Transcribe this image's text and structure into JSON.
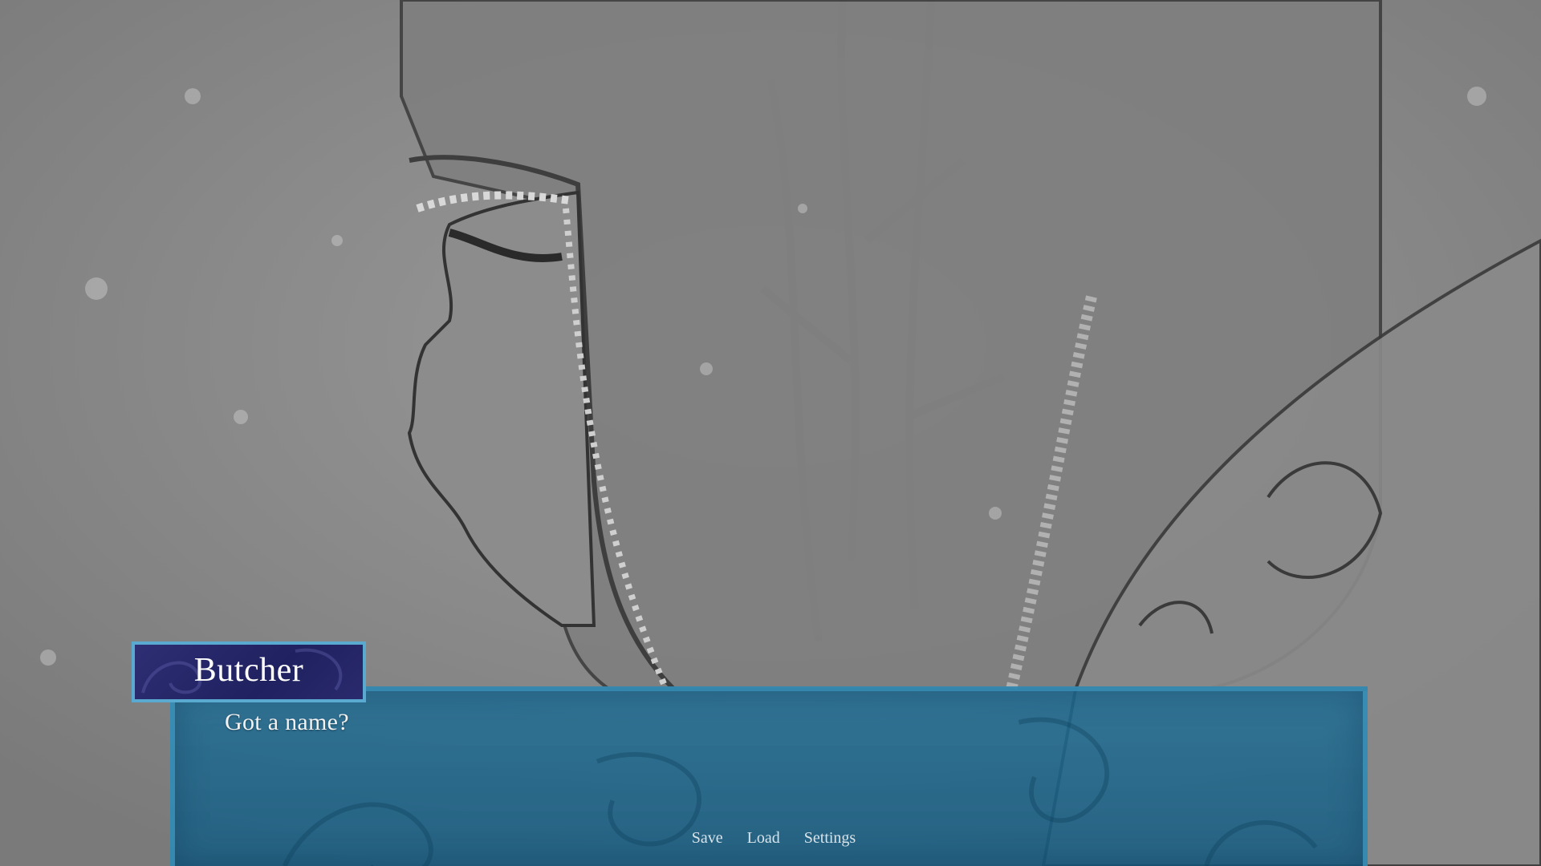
{
  "speaker": {
    "name": "Butcher"
  },
  "dialogue": {
    "text": "Got a name?"
  },
  "quick_menu": {
    "save": "Save",
    "load": "Load",
    "settings": "Settings"
  },
  "colors": {
    "dialogue_box": "#1e6e96",
    "namebox": "#23246a",
    "namebox_border": "#5aa9d0"
  }
}
